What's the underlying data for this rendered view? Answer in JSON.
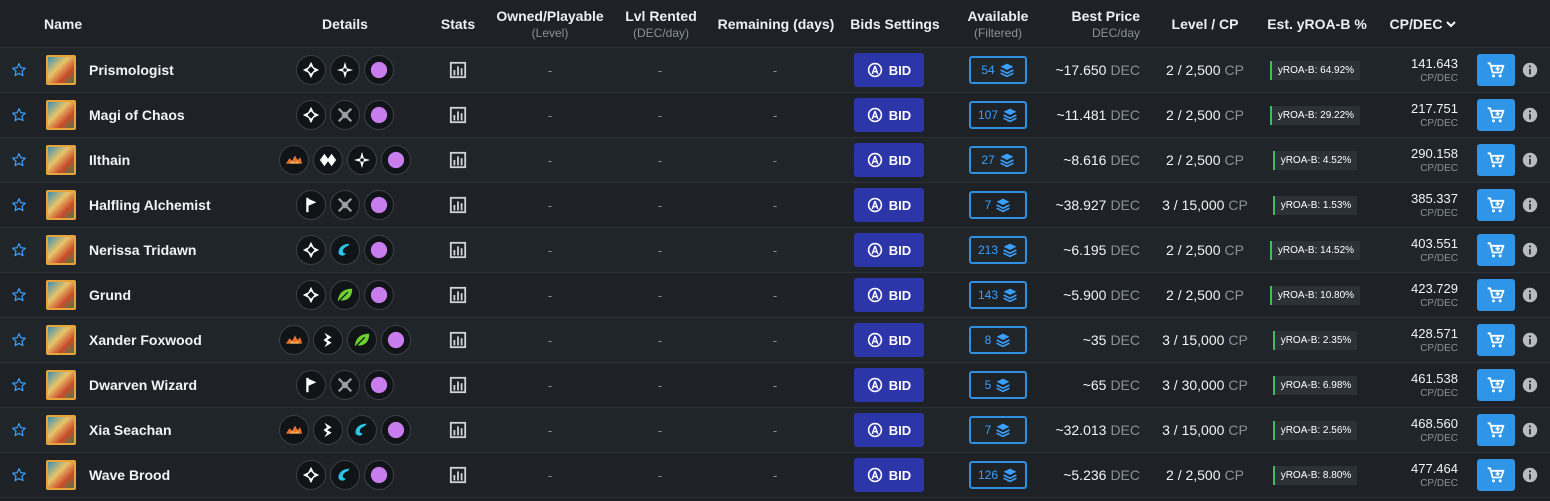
{
  "header": {
    "name": "Name",
    "details": "Details",
    "stats": "Stats",
    "owned": "Owned/Playable",
    "owned_sub": "(Level)",
    "rented": "Lvl Rented",
    "rented_sub": "(DEC/day)",
    "remaining": "Remaining (days)",
    "bids": "Bids Settings",
    "available": "Available",
    "available_sub": "(Filtered)",
    "price": "Best Price",
    "price_sub": "DEC/day",
    "level": "Level / CP",
    "yroa": "Est. yROA-B %",
    "cpdec": "CP/DEC"
  },
  "labels": {
    "bid": "BID",
    "dec": "DEC",
    "cp": "CP",
    "cpdec_unit": "CP/DEC",
    "dash": "-"
  },
  "icon_colors": {
    "neutral": "#ffffff",
    "fire": "#e8742e",
    "water": "#29c6e8",
    "earth": "#6bd12e",
    "magic": "#c77dee",
    "cart": "#ffffff"
  },
  "rows": [
    {
      "name": "Prismologist",
      "icons": [
        "diamond-cross-icon",
        "compass-star-icon",
        "magic-orb-icon"
      ],
      "owned": "-",
      "rented": "-",
      "remaining": "-",
      "available": "54",
      "price": "~17.650",
      "level": "2 / 2,500",
      "yroa": "yROA-B: 64.92%",
      "cpdec": "141.643"
    },
    {
      "name": "Magi of Chaos",
      "icons": [
        "diamond-cross-icon",
        "crossed-swords-icon",
        "magic-orb-icon"
      ],
      "owned": "-",
      "rented": "-",
      "remaining": "-",
      "available": "107",
      "price": "~11.481",
      "level": "2 / 2,500",
      "yroa": "yROA-B: 29.22%",
      "cpdec": "217.751"
    },
    {
      "name": "Ilthain",
      "icons": [
        "fire-icon",
        "double-diamond-icon",
        "compass-star-icon",
        "magic-orb-icon"
      ],
      "owned": "-",
      "rented": "-",
      "remaining": "-",
      "available": "27",
      "price": "~8.616",
      "level": "2 / 2,500",
      "yroa": "yROA-B: 4.52%",
      "cpdec": "290.158"
    },
    {
      "name": "Halfling Alchemist",
      "icons": [
        "flag-icon",
        "crossed-swords-icon",
        "magic-orb-icon"
      ],
      "owned": "-",
      "rented": "-",
      "remaining": "-",
      "available": "7",
      "price": "~38.927",
      "level": "3 / 15,000",
      "yroa": "yROA-B: 1.53%",
      "cpdec": "385.337"
    },
    {
      "name": "Nerissa Tridawn",
      "icons": [
        "diamond-cross-icon",
        "water-icon",
        "magic-orb-icon"
      ],
      "owned": "-",
      "rented": "-",
      "remaining": "-",
      "available": "213",
      "price": "~6.195",
      "level": "2 / 2,500",
      "yroa": "yROA-B: 14.52%",
      "cpdec": "403.551"
    },
    {
      "name": "Grund",
      "icons": [
        "diamond-cross-icon",
        "leaf-icon",
        "magic-orb-icon"
      ],
      "owned": "-",
      "rented": "-",
      "remaining": "-",
      "available": "143",
      "price": "~5.900",
      "level": "2 / 2,500",
      "yroa": "yROA-B: 10.80%",
      "cpdec": "423.729"
    },
    {
      "name": "Xander Foxwood",
      "icons": [
        "fire-icon",
        "lightning-icon",
        "leaf-icon",
        "magic-orb-icon"
      ],
      "owned": "-",
      "rented": "-",
      "remaining": "-",
      "available": "8",
      "price": "~35",
      "level": "3 / 15,000",
      "yroa": "yROA-B: 2.35%",
      "cpdec": "428.571"
    },
    {
      "name": "Dwarven Wizard",
      "icons": [
        "flag-icon",
        "crossed-swords-icon",
        "magic-orb-icon"
      ],
      "owned": "-",
      "rented": "-",
      "remaining": "-",
      "available": "5",
      "price": "~65",
      "level": "3 / 30,000",
      "yroa": "yROA-B: 6.98%",
      "cpdec": "461.538"
    },
    {
      "name": "Xia Seachan",
      "icons": [
        "fire-icon",
        "lightning-icon",
        "water-icon",
        "magic-orb-icon"
      ],
      "owned": "-",
      "rented": "-",
      "remaining": "-",
      "available": "7",
      "price": "~32.013",
      "level": "3 / 15,000",
      "yroa": "yROA-B: 2.56%",
      "cpdec": "468.560"
    },
    {
      "name": "Wave Brood",
      "icons": [
        "diamond-cross-icon",
        "water-icon",
        "magic-orb-icon"
      ],
      "owned": "-",
      "rented": "-",
      "remaining": "-",
      "available": "126",
      "price": "~5.236",
      "level": "2 / 2,500",
      "yroa": "yROA-B: 8.80%",
      "cpdec": "477.464"
    }
  ]
}
